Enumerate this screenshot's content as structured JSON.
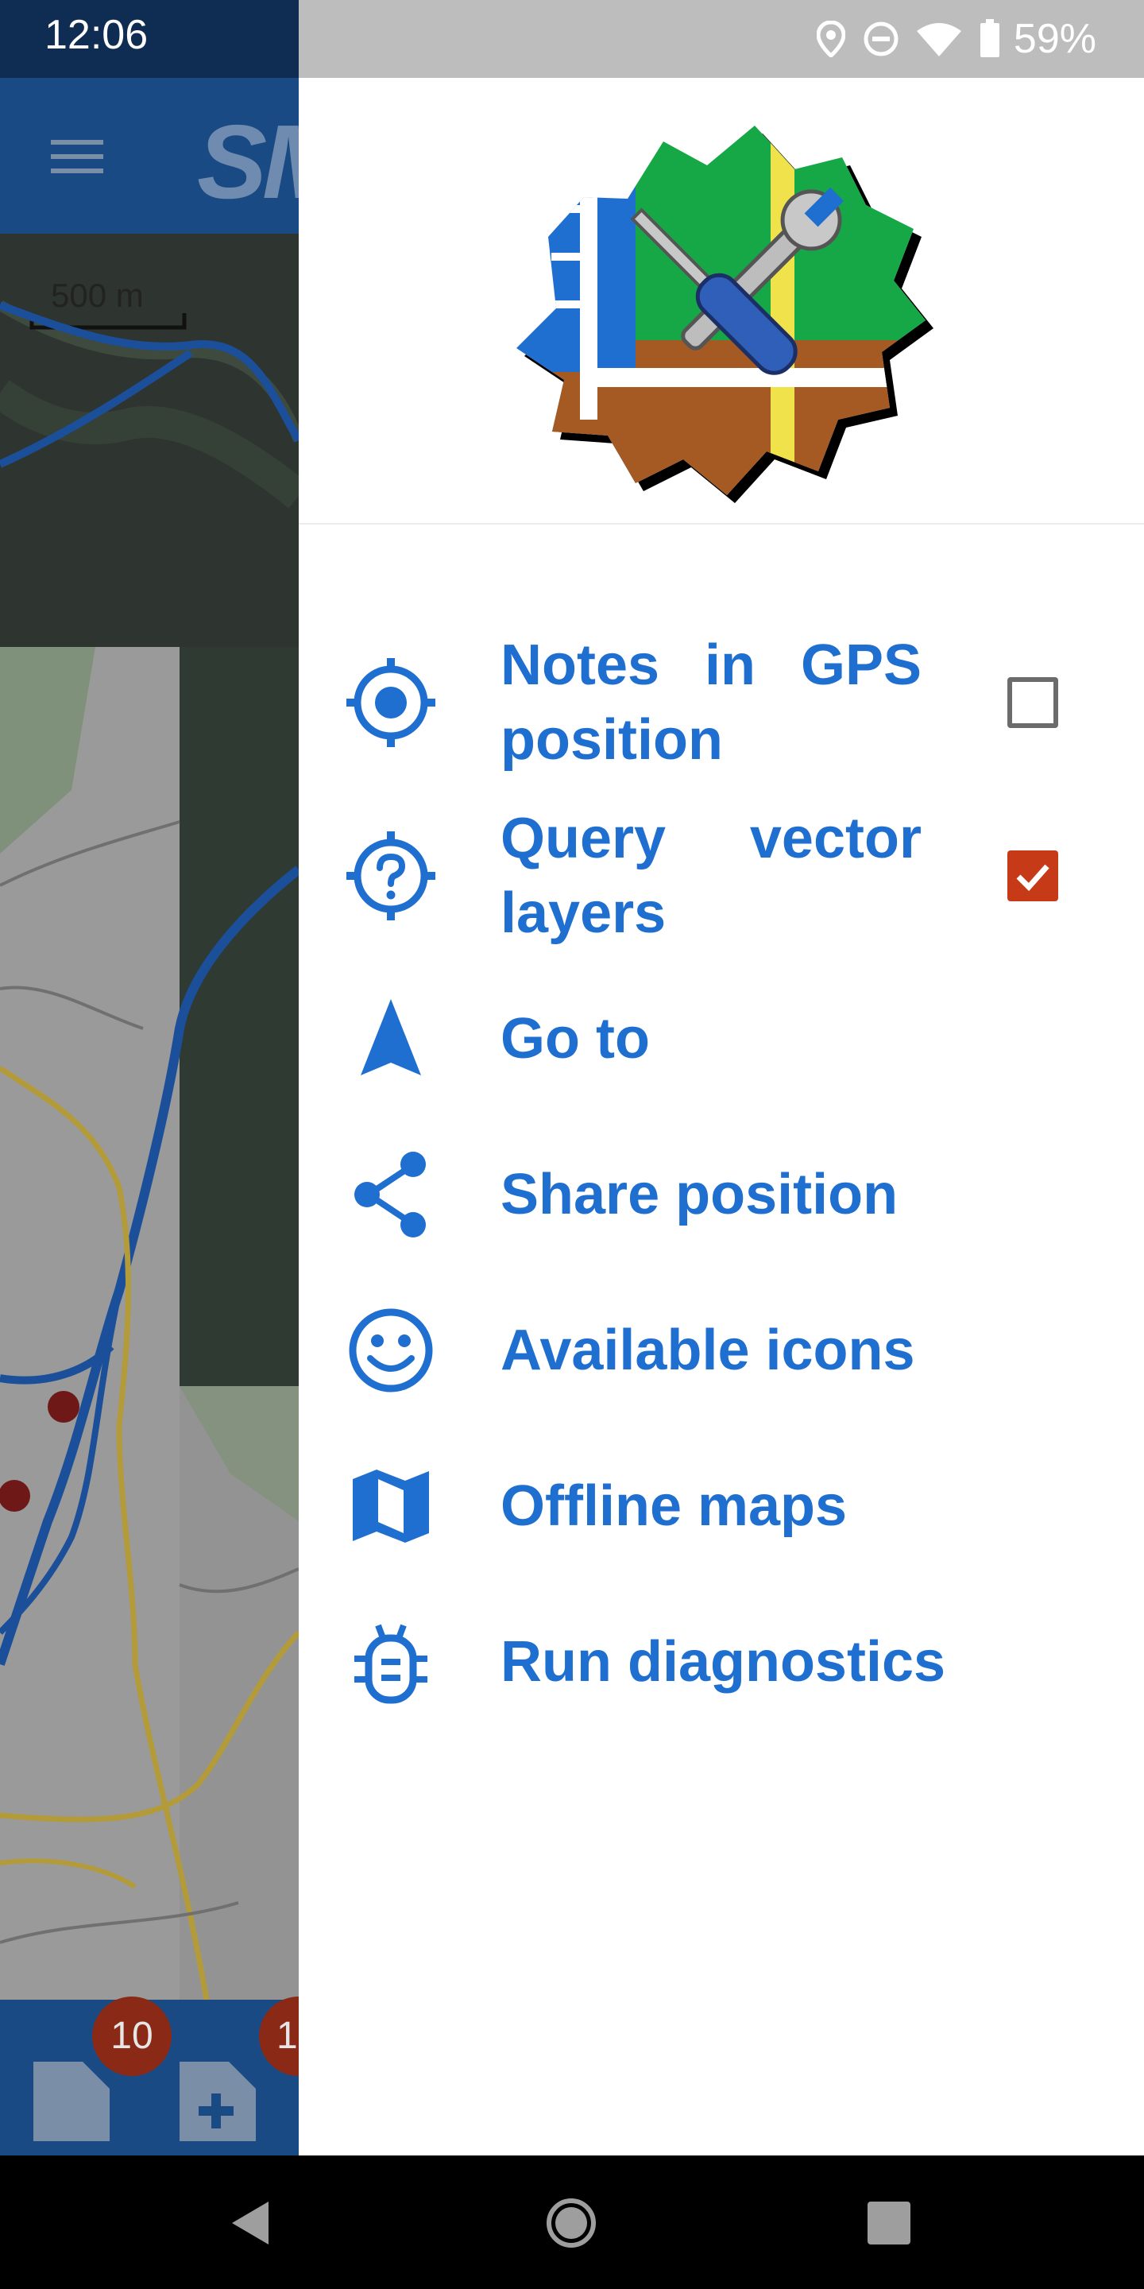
{
  "background_app": {
    "status_time": "12:06",
    "title_fragment": "SM",
    "badge_count": "10",
    "badge_partial": "1",
    "scale_label": "500 m"
  },
  "status_bar": {
    "battery_text": "59%",
    "icons": [
      "location-pin-icon",
      "do-not-disturb-icon",
      "wifi-icon",
      "battery-icon"
    ]
  },
  "drawer": {
    "menu": [
      {
        "label": "Notes in GPS position",
        "icon": "gps-crosshair-icon",
        "checkbox": true,
        "checked": false
      },
      {
        "label": "Query vector layers",
        "icon": "question-crosshair-icon",
        "checkbox": true,
        "checked": true
      },
      {
        "label": "Go to",
        "icon": "navigation-arrow-icon"
      },
      {
        "label": "Share position",
        "icon": "share-icon"
      },
      {
        "label": "Available icons",
        "icon": "smiley-icon"
      },
      {
        "label": "Offline maps",
        "icon": "map-icon"
      },
      {
        "label": "Run diagnostics",
        "icon": "bug-icon"
      }
    ]
  },
  "colors": {
    "accent": "#1f6fd0",
    "checkbox_checked": "#c73a17",
    "checkbox_unchecked": "#6b6b6b",
    "status_bar": "#bdbdbd"
  },
  "nav_bar": {
    "buttons": [
      "back-button",
      "home-button",
      "recents-button"
    ]
  }
}
